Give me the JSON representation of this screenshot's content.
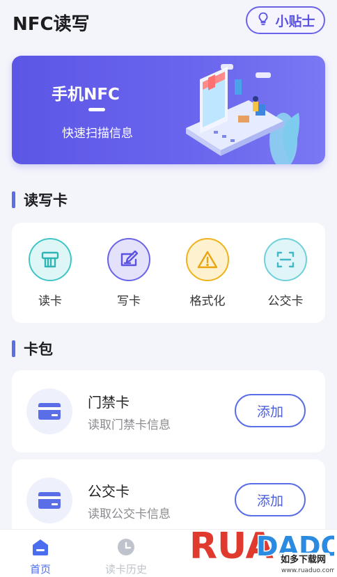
{
  "header": {
    "title": "NFC读写",
    "tips_label": "小贴士"
  },
  "banner": {
    "title": "手机NFC",
    "subtitle": "快速扫描信息"
  },
  "read_write": {
    "section_title": "读写卡",
    "tools": [
      {
        "label": "读卡",
        "icon": "card-reader-icon",
        "color": "#3fc6c6",
        "bg": "#dff6f6"
      },
      {
        "label": "写卡",
        "icon": "pencil-card-icon",
        "color": "#5a52e0",
        "bg": "#e4e1fb"
      },
      {
        "label": "格式化",
        "icon": "warning-icon",
        "color": "#f0b21a",
        "bg": "#fdf1cf"
      },
      {
        "label": "公交卡",
        "icon": "scan-icon",
        "color": "#3fb8c6",
        "bg": "#e0f5f7"
      }
    ]
  },
  "wallet": {
    "section_title": "卡包",
    "cards": [
      {
        "name": "门禁卡",
        "desc": "读取门禁卡信息",
        "button": "添加"
      },
      {
        "name": "公交卡",
        "desc": "读取公交卡信息",
        "button": "添加"
      }
    ]
  },
  "nav": {
    "items": [
      {
        "label": "首页",
        "icon": "home-icon",
        "active": true
      },
      {
        "label": "读卡历史",
        "icon": "clock-icon",
        "active": false
      }
    ],
    "active_color": "#4b6ef0",
    "inactive_color": "#bfc3cc"
  },
  "watermark": {
    "logo": "RUANDADO",
    "text": "如多下载网",
    "url": "www.ruaduo.com"
  }
}
